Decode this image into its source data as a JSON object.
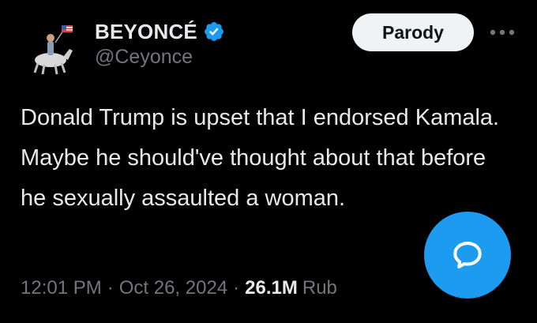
{
  "tweet": {
    "display_name": "BEYONCÉ",
    "handle": "@Ceyonce",
    "verified_icon": "verified-badge-icon",
    "text": "Donald Trump is upset that I endorsed Kamala. Maybe he should've thought about that before he sexually assaulted a woman.",
    "time": "12:01 PM",
    "separator": "·",
    "date": "Oct 26, 2024",
    "views_count": "26.1M",
    "views_label": "Rub"
  },
  "actions": {
    "parody_label": "Parody",
    "more_icon": "more-horizontal-icon",
    "compose_icon": "chat-bubble-icon"
  },
  "colors": {
    "background": "#000000",
    "text_primary": "#e7e9ea",
    "text_secondary": "#71767b",
    "accent_blue": "#1d9bf0",
    "button_light": "#eff3f4"
  }
}
